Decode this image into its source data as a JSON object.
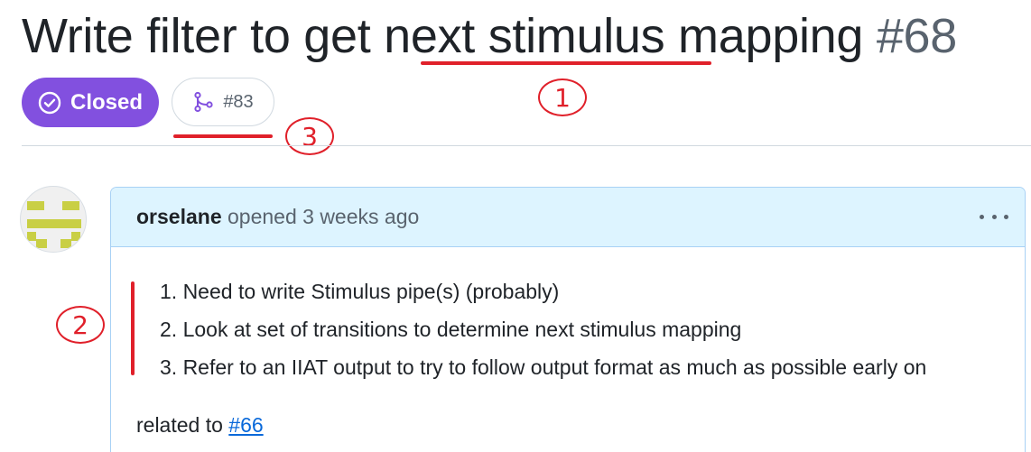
{
  "issue": {
    "title_pre": "Write filter to get ",
    "title_highlight": "next stimulus",
    "title_post": " mapping ",
    "number": "#68",
    "state_label": "Closed",
    "state_color": "#8250df",
    "linked_pr": "#83"
  },
  "annotations": {
    "marker_1": "1",
    "marker_2": "2",
    "marker_3": "3",
    "color": "#e0202a"
  },
  "comment": {
    "author": "orselane",
    "action": " opened 3 weeks ago",
    "list": [
      "1. Need to write Stimulus pipe(s) (probably)",
      "2. Look at set of transitions to determine next stimulus mapping",
      "3. Refer to an IIAT output to try to follow output format as much as possible early on"
    ],
    "related_prefix": "related to ",
    "related_link": "#66"
  },
  "icons": {
    "state": "check-circle-icon",
    "pr": "git-pull-request-icon",
    "menu": "kebab-horizontal-icon"
  }
}
